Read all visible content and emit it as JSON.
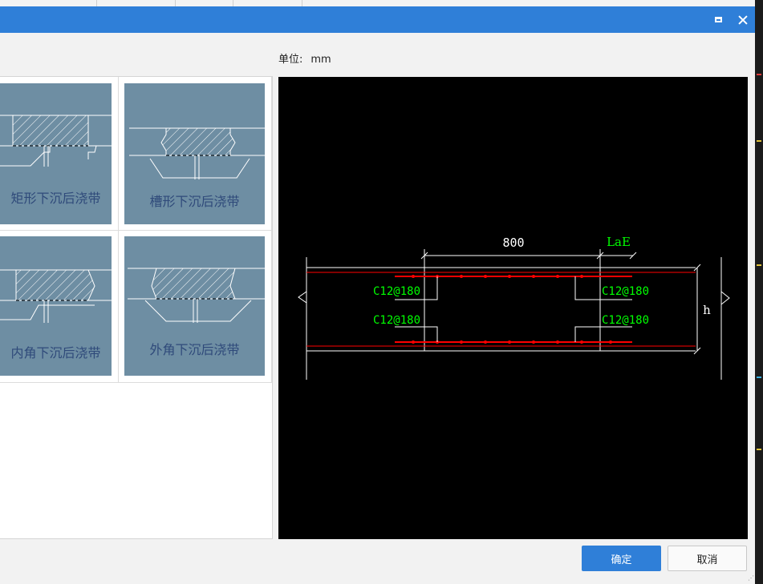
{
  "window": {
    "title": "",
    "maximize_icon": "maximize-icon",
    "close_icon": "close-icon"
  },
  "unit": {
    "label": "单位:",
    "value": "mm"
  },
  "options": [
    {
      "label": "矩形下沉后浇带"
    },
    {
      "label": "槽形下沉后浇带"
    },
    {
      "label": "内角下沉后浇带"
    },
    {
      "label": "外角下沉后浇带"
    }
  ],
  "preview": {
    "dim_width": "800",
    "dim_anchor": "LaE",
    "rebar_top_left": "C12@180",
    "rebar_top_right": "C12@180",
    "rebar_bottom_left": "C12@180",
    "rebar_bottom_right": "C12@180",
    "dim_height": "h"
  },
  "buttons": {
    "ok": "确定",
    "cancel": "取消"
  },
  "colors": {
    "titlebar": "#2f7fd8",
    "thumb_bg": "#6e8ea3",
    "cad_green": "#00ff00",
    "cad_red": "#ff0000"
  }
}
